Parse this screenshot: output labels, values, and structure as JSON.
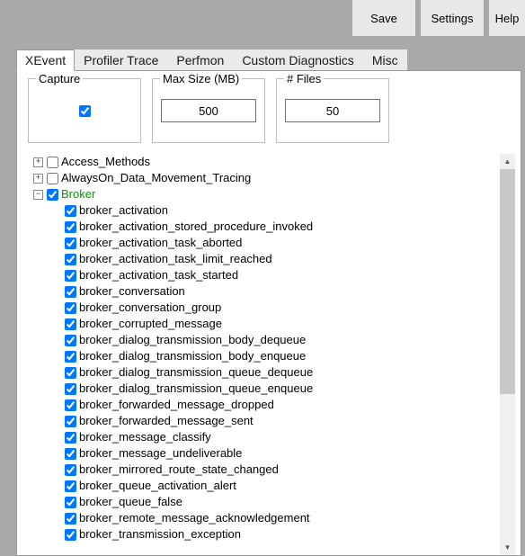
{
  "toolbar": {
    "save_label": "Save",
    "settings_label": "Settings",
    "help_label": "Help"
  },
  "tabs": {
    "xevent": "XEvent",
    "profiler": "Profiler Trace",
    "perfmon": "Perfmon",
    "custom": "Custom Diagnostics",
    "misc": "Misc"
  },
  "groupboxes": {
    "capture_title": "Capture",
    "maxsize_title": "Max Size (MB)",
    "maxsize_value": "500",
    "files_title": "# Files",
    "files_value": "50"
  },
  "tree_glyphs": {
    "plus": "+",
    "minus": "−"
  },
  "scrollbar": {
    "up": "▲",
    "down": "▼"
  },
  "tree": {
    "top": [
      {
        "name": "Access_Methods",
        "expanded": false,
        "checked": false
      },
      {
        "name": "AlwaysOn_Data_Movement_Tracing",
        "expanded": false,
        "checked": false
      }
    ],
    "expanded": {
      "name": "Broker",
      "checked": true,
      "children": [
        "broker_activation",
        "broker_activation_stored_procedure_invoked",
        "broker_activation_task_aborted",
        "broker_activation_task_limit_reached",
        "broker_activation_task_started",
        "broker_conversation",
        "broker_conversation_group",
        "broker_corrupted_message",
        "broker_dialog_transmission_body_dequeue",
        "broker_dialog_transmission_body_enqueue",
        "broker_dialog_transmission_queue_dequeue",
        "broker_dialog_transmission_queue_enqueue",
        "broker_forwarded_message_dropped",
        "broker_forwarded_message_sent",
        "broker_message_classify",
        "broker_message_undeliverable",
        "broker_mirrored_route_state_changed",
        "broker_queue_activation_alert",
        "broker_queue_false",
        "broker_remote_message_acknowledgement",
        "broker_transmission_exception"
      ]
    }
  }
}
